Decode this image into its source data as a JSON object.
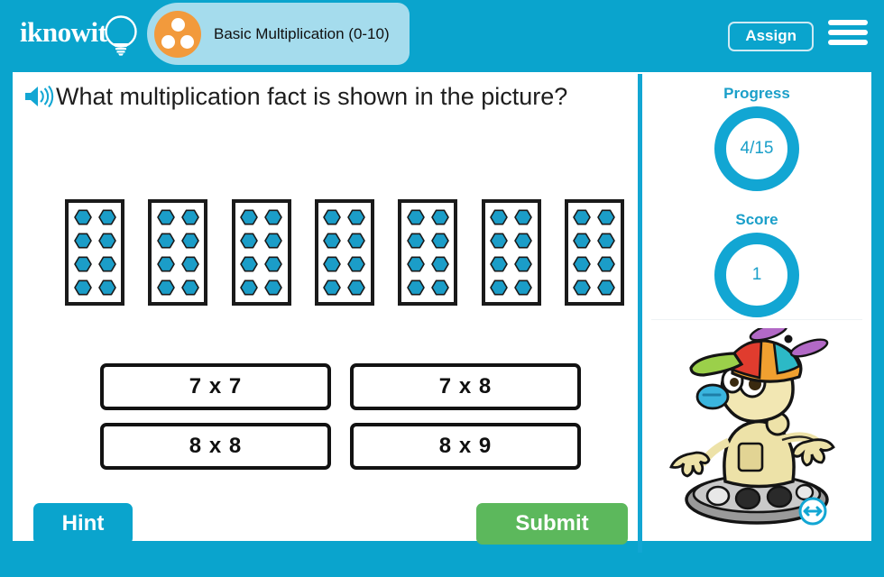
{
  "header": {
    "logo_text": "iknowit",
    "logo_icon": "lightbulb-icon",
    "topic_badge_icon": "three-dots-circle-icon",
    "topic_title": "Basic Multiplication (0-10)",
    "assign_label": "Assign",
    "menu_icon": "hamburger-menu-icon"
  },
  "question": {
    "audio_icon": "speaker-icon",
    "text": "What multiplication fact is shown in the picture?"
  },
  "illustration": {
    "group_count": 7,
    "items_per_group": 8,
    "item_rows": 4,
    "item_cols": 2,
    "item_shape": "hexagon",
    "item_color": "#1b9dc8"
  },
  "answers": [
    {
      "label": "7 x 7"
    },
    {
      "label": "7 x 8"
    },
    {
      "label": "8 x 8"
    },
    {
      "label": "8 x 9"
    }
  ],
  "actions": {
    "hint_label": "Hint",
    "submit_label": "Submit"
  },
  "sidebar": {
    "progress_label": "Progress",
    "progress_value": "4/15",
    "score_label": "Score",
    "score_value": "1",
    "mascot_icon": "robot-mascot-icon",
    "resize_icon": "horizontal-resize-icon"
  },
  "colors": {
    "brand_blue": "#0aa4cd",
    "light_blue": "#a5dced",
    "orange": "#f29a3c",
    "green": "#5cb85c",
    "hex_blue": "#1b9dc8"
  }
}
